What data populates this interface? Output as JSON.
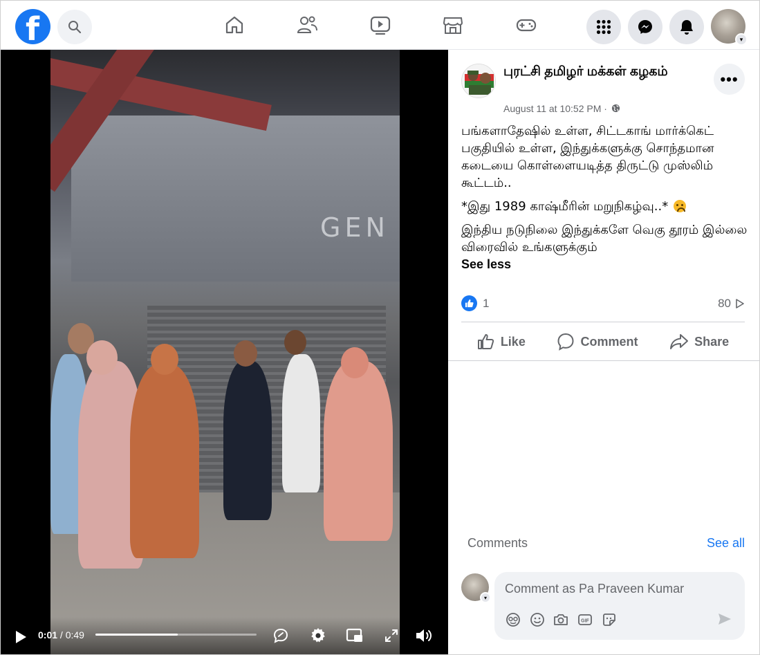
{
  "topbar": {
    "logo_letter": "f",
    "icons": [
      "search-icon",
      "home-icon",
      "friends-icon",
      "watch-icon",
      "marketplace-icon",
      "gaming-icon",
      "menu-grid-icon",
      "messenger-icon",
      "notifications-icon"
    ],
    "accent": "#1877f2"
  },
  "video": {
    "current_time": "0:01",
    "total_time": "/ 0:49",
    "progress": 0.51,
    "sign_text": "GEN"
  },
  "post": {
    "page_name": "புரட்சி தமிழர் மக்கள் கழகம்",
    "timestamp": "August 11 at 10:52 PM ·",
    "paragraph1": "பங்களாதேஷில் உள்ள, சிட்டகாங் மார்க்கெட் பகுதியில் உள்ள, இந்துக்களுக்கு சொந்தமான கடையை கொள்ளையடித்த திருட்டு முஸ்லிம் கூட்டம்..",
    "paragraph2": "*இது 1989 காஷ்மீரின் மறுநிகழ்வு..*",
    "paragraph3": "இந்திய நடுநிலை இந்துக்களே வெகு தூரம் இல்லை விரைவில் உங்களுக்கும்",
    "see_less": "See less",
    "like_count": "1",
    "view_count": "80"
  },
  "actions": {
    "like": "Like",
    "comment": "Comment",
    "share": "Share"
  },
  "comments": {
    "label": "Comments",
    "see_all": "See all",
    "placeholder": "Comment as Pa Praveen Kumar"
  }
}
